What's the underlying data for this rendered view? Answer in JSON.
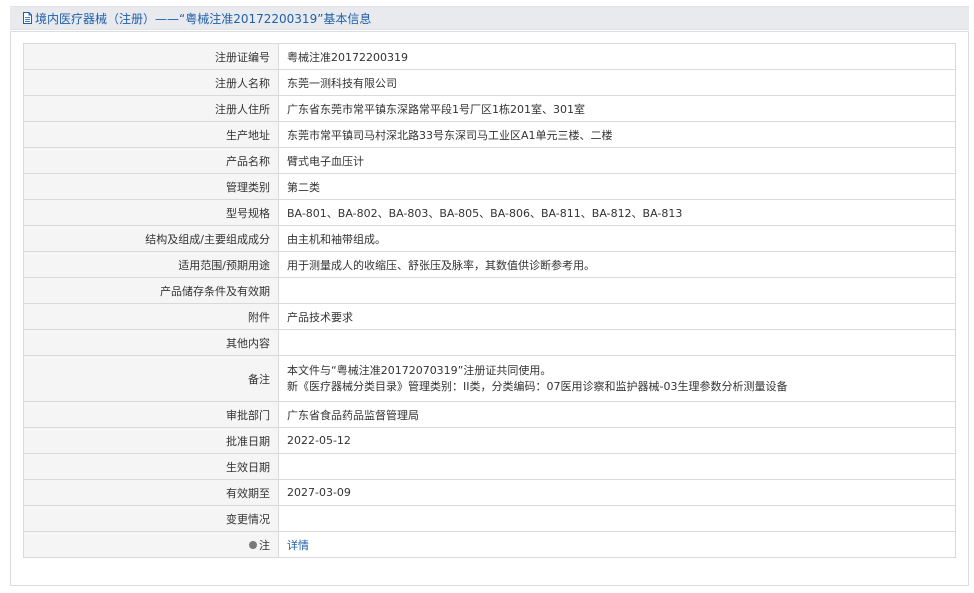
{
  "header": {
    "title": "境内医疗器械（注册）——“粤械注准20172200319”基本信息",
    "icon": "document-icon"
  },
  "table": {
    "rows": [
      {
        "label": "注册证编号",
        "value": "粤械注准20172200319"
      },
      {
        "label": "注册人名称",
        "value": "东莞一测科技有限公司"
      },
      {
        "label": "注册人住所",
        "value": "广东省东莞市常平镇东深路常平段1号厂区1栋201室、301室"
      },
      {
        "label": "生产地址",
        "value": "东莞市常平镇司马村深北路33号东深司马工业区A1单元三楼、二楼"
      },
      {
        "label": "产品名称",
        "value": "臂式电子血压计"
      },
      {
        "label": "管理类别",
        "value": "第二类"
      },
      {
        "label": "型号规格",
        "value": "BA-801、BA-802、BA-803、BA-805、BA-806、BA-811、BA-812、BA-813"
      },
      {
        "label": "结构及组成/主要组成成分",
        "value": "由主机和袖带组成。"
      },
      {
        "label": "适用范围/预期用途",
        "value": "用于测量成人的收缩压、舒张压及脉率，其数值供诊断参考用。"
      },
      {
        "label": "产品储存条件及有效期",
        "value": ""
      },
      {
        "label": "附件",
        "value": "产品技术要求"
      },
      {
        "label": "其他内容",
        "value": ""
      }
    ],
    "remark": {
      "label": "备注",
      "line1": "本文件与“粤械注准20172070319”注册证共同使用。",
      "line2": "新《医疗器械分类目录》管理类别：II类，分类编码：07医用诊察和监护器械-03生理参数分析测量设备"
    },
    "rows2": [
      {
        "label": "审批部门",
        "value": "广东省食品药品监督管理局"
      },
      {
        "label": "批准日期",
        "value": "2022-05-12"
      },
      {
        "label": "生效日期",
        "value": ""
      },
      {
        "label": "有效期至",
        "value": "2027-03-09"
      },
      {
        "label": "变更情况",
        "value": ""
      }
    ],
    "note": {
      "label": "注",
      "icon": "pin-icon",
      "link": "详情",
      "link_color": "#1f5fa8"
    }
  }
}
